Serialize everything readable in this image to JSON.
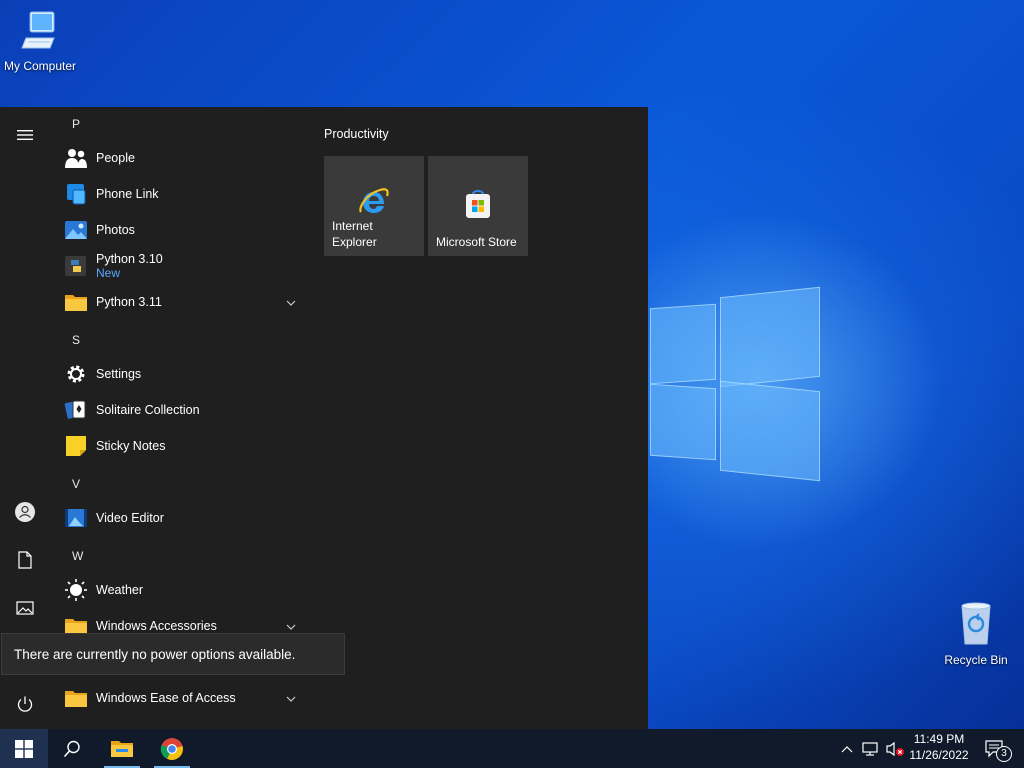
{
  "desktop": {
    "icons": [
      {
        "label": "My Computer"
      },
      {
        "label": "Recycle Bin"
      }
    ]
  },
  "start_menu": {
    "groups": [
      {
        "letter": "P"
      },
      {
        "letter": "S"
      },
      {
        "letter": "V"
      },
      {
        "letter": "W"
      }
    ],
    "apps": [
      {
        "name": "People"
      },
      {
        "name": "Phone Link"
      },
      {
        "name": "Photos"
      },
      {
        "name": "Python 3.10",
        "sub": "New"
      },
      {
        "name": "Python 3.11"
      },
      {
        "name": "Settings"
      },
      {
        "name": "Solitaire Collection"
      },
      {
        "name": "Sticky Notes"
      },
      {
        "name": "Video Editor"
      },
      {
        "name": "Weather"
      },
      {
        "name": "Windows Accessories"
      },
      {
        "name": "Windows Ease of Access"
      }
    ],
    "tiles_heading": "Productivity",
    "tiles": [
      {
        "line1": "Internet",
        "line2": "Explorer"
      },
      {
        "line1": "",
        "line2": "Microsoft Store"
      }
    ],
    "tooltip": "There are currently no power options available."
  },
  "taskbar": {
    "time": "11:49 PM",
    "date": "11/26/2022",
    "notification_count": "3"
  },
  "colors": {
    "start_bg": "#1f1f1f",
    "accent": "#5aa7ff",
    "taskbar_bg": "#101a2b"
  }
}
